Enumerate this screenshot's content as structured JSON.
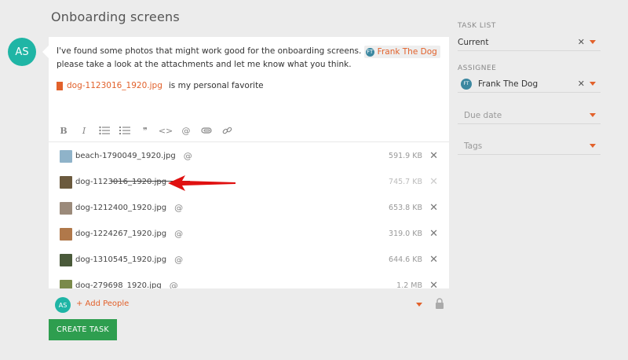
{
  "page": {
    "title": "Onboarding screens"
  },
  "author": {
    "initials": "AS"
  },
  "message": {
    "text_before": "I've found some photos that might work good for the onboarding screens.",
    "mention": {
      "name": "Frank The Dog",
      "initials": "FT"
    },
    "text_after": "please take a look at the attachments and let me know what you think.",
    "file_link": "dog-1123016_1920.jpg",
    "file_comment": "is my personal favorite"
  },
  "toolbar": {
    "items": [
      {
        "name": "bold-icon",
        "glyph": "B"
      },
      {
        "name": "italic-icon",
        "glyph": "I"
      },
      {
        "name": "bullet-list-icon",
        "glyph": ""
      },
      {
        "name": "numbered-list-icon",
        "glyph": ""
      },
      {
        "name": "quote-icon",
        "glyph": "❞"
      },
      {
        "name": "code-icon",
        "glyph": "<>"
      },
      {
        "name": "mention-icon",
        "glyph": "@"
      },
      {
        "name": "attach-icon",
        "glyph": ""
      },
      {
        "name": "link-icon",
        "glyph": ""
      }
    ]
  },
  "attachments": [
    {
      "name": "beach-1790049_1920.jpg",
      "size": "591.9 KB",
      "thumb_color": "#8fb3c9"
    },
    {
      "name": "dog-1123016_1920.jpg",
      "size": "745.7 KB",
      "thumb_color": "#6b5a3e"
    },
    {
      "name": "dog-1212400_1920.jpg",
      "size": "653.8 KB",
      "thumb_color": "#9b8a7a"
    },
    {
      "name": "dog-1224267_1920.jpg",
      "size": "319.0 KB",
      "thumb_color": "#b0784a"
    },
    {
      "name": "dog-1310545_1920.jpg",
      "size": "644.6 KB",
      "thumb_color": "#4a5a3a"
    },
    {
      "name": "dog-279698_1920.jpg",
      "size": "1.2 MB",
      "thumb_color": "#7a8a4a"
    }
  ],
  "footer": {
    "add_people": "+ Add People",
    "initials": "AS"
  },
  "create_button": "CREATE TASK",
  "sidebar": {
    "task_list": {
      "label": "TASK LIST",
      "value": "Current"
    },
    "assignee": {
      "label": "ASSIGNEE",
      "value": "Frank The Dog",
      "initials": "FT"
    },
    "due_date": {
      "placeholder": "Due date"
    },
    "tags": {
      "placeholder": "Tags"
    }
  },
  "colors": {
    "accent": "#e2612b",
    "avatar": "#1fb5a5",
    "create": "#2e9e4f",
    "arrow": "#e01010"
  }
}
